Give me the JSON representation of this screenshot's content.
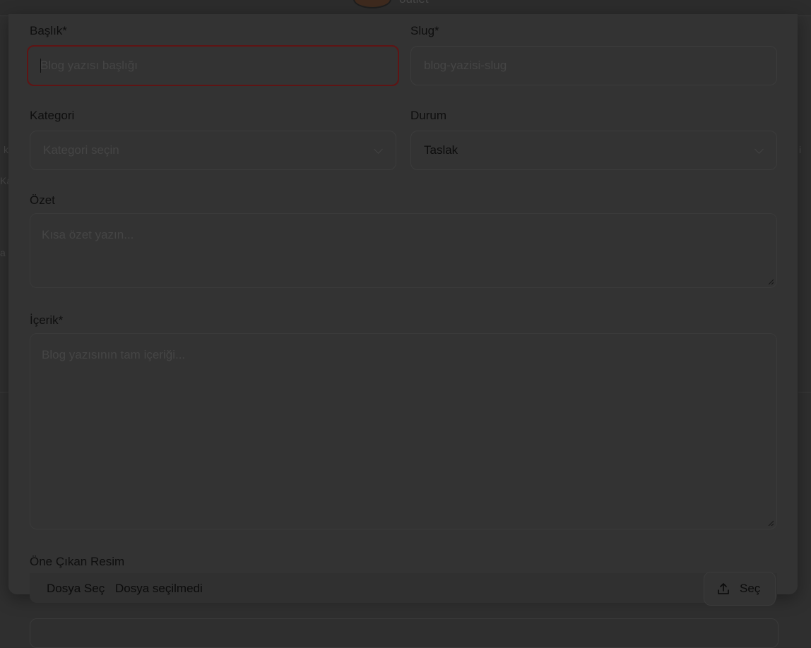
{
  "background": {
    "brand_text": "outlet",
    "fragments": [
      "k",
      "Ka",
      "a",
      "i"
    ]
  },
  "form": {
    "title": {
      "label": "Başlık*",
      "placeholder": "Blog yazısı başlığı"
    },
    "slug": {
      "label": "Slug*",
      "placeholder": "blog-yazisi-slug"
    },
    "category": {
      "label": "Kategori",
      "placeholder": "Kategori seçin"
    },
    "status": {
      "label": "Durum",
      "value": "Taslak"
    },
    "summary": {
      "label": "Özet",
      "placeholder": "Kısa özet yazın..."
    },
    "content": {
      "label": "İçerik*",
      "placeholder": "Blog yazısının tam içeriği..."
    },
    "featured_image": {
      "label": "Öne Çıkan Resim",
      "choose_button": "Dosya Seç",
      "no_file": "Dosya seçilmedi",
      "select_button": "Seç"
    }
  },
  "colors": {
    "focus_border": "#5f1414",
    "overlay": "#2f2f2f"
  }
}
